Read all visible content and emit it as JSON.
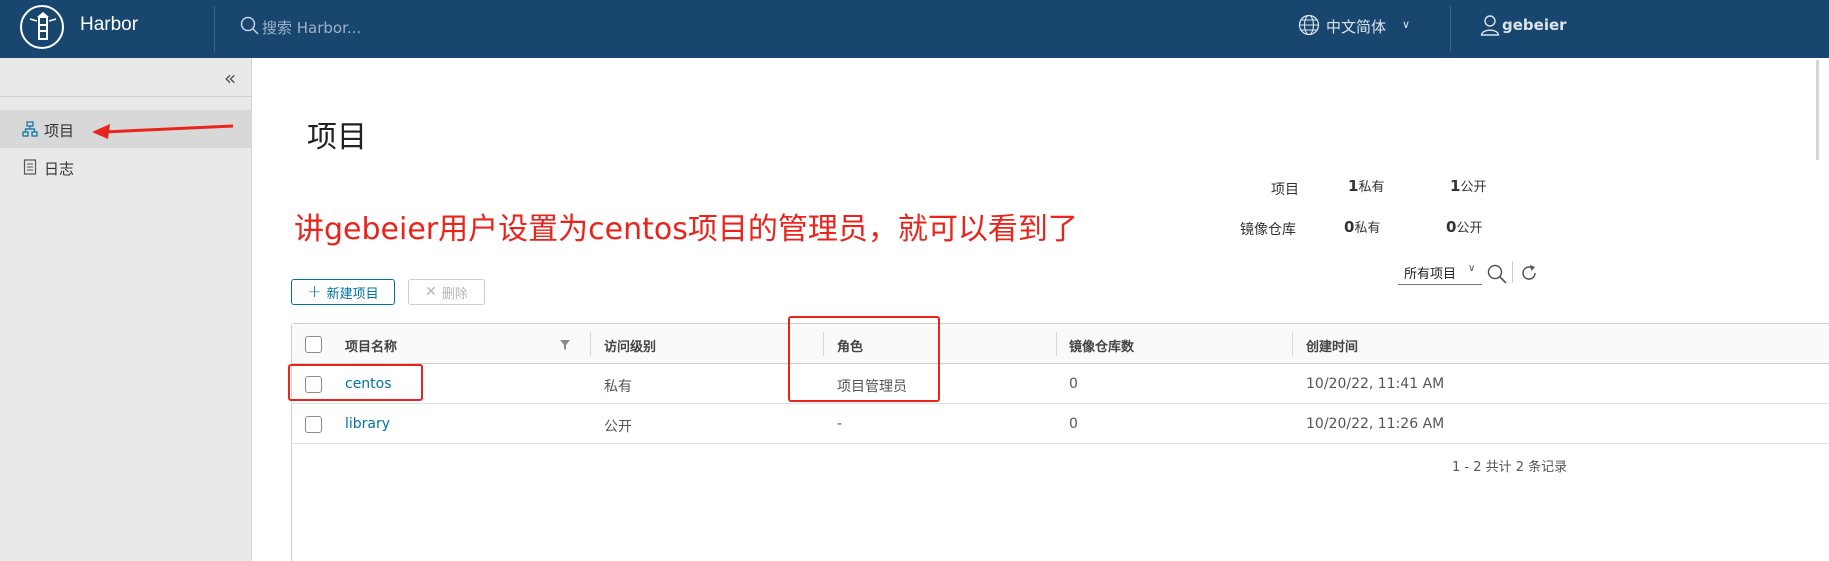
{
  "header": {
    "brand": "Harbor",
    "search_placeholder": "搜索 Harbor...",
    "language": "中文简体",
    "user": "gebeier"
  },
  "sidebar": {
    "items": [
      {
        "label": "项目",
        "icon": "project-icon",
        "active": true
      },
      {
        "label": "日志",
        "icon": "log-icon",
        "active": false
      }
    ]
  },
  "main": {
    "title": "项目",
    "annotation": "讲gebeier用户设置为centos项目的管理员，就可以看到了",
    "stats": {
      "projects_label": "项目",
      "projects_private": "1",
      "projects_public": "1",
      "repos_label": "镜像仓库",
      "repos_private": "0",
      "repos_public": "0",
      "private_label": "私有",
      "public_label": "公开"
    },
    "buttons": {
      "new_project": "新建项目",
      "delete": "删除"
    },
    "filter": "所有项目",
    "table": {
      "columns": [
        "项目名称",
        "访问级别",
        "角色",
        "镜像仓库数",
        "创建时间"
      ],
      "rows": [
        {
          "name": "centos",
          "access": "私有",
          "role": "项目管理员",
          "repos": "0",
          "created": "10/20/22, 11:41 AM"
        },
        {
          "name": "library",
          "access": "公开",
          "role": "-",
          "repos": "0",
          "created": "10/20/22, 11:26 AM"
        }
      ],
      "footer": "1 - 2 共计 2 条记录"
    }
  },
  "colors": {
    "header_bg": "#19466e",
    "accent": "#0072a3",
    "annotation": "#e8241c"
  }
}
